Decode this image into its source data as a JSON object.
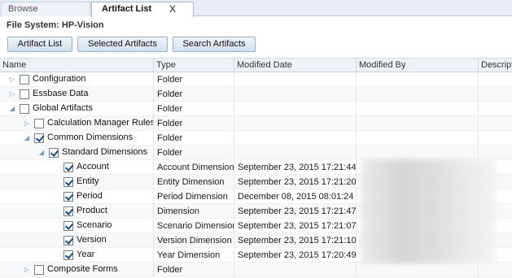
{
  "tabs": [
    {
      "label": "Browse"
    },
    {
      "label": "Artifact List",
      "close": "X"
    }
  ],
  "file_system_label": "File System: HP-Vision",
  "buttons": {
    "artifact_list": "Artifact List",
    "selected_artifacts": "Selected Artifacts",
    "search_artifacts": "Search Artifacts"
  },
  "columns": [
    "Name",
    "Type",
    "Modified Date",
    "Modified By",
    "Descript"
  ],
  "rows": [
    {
      "name": "Configuration",
      "type": "Folder",
      "date": "",
      "checked": false,
      "expander": "collapsed"
    },
    {
      "name": "Essbase Data",
      "type": "Folder",
      "date": "",
      "checked": false,
      "expander": "collapsed"
    },
    {
      "name": "Global Artifacts",
      "type": "Folder",
      "date": "",
      "checked": false,
      "expander": "expanded"
    },
    {
      "name": "Calculation Manager Rulesets",
      "type": "Folder",
      "date": "",
      "checked": false,
      "expander": "collapsed"
    },
    {
      "name": "Common Dimensions",
      "type": "Folder",
      "date": "",
      "checked": true,
      "expander": "expanded"
    },
    {
      "name": "Standard Dimensions",
      "type": "Folder",
      "date": "",
      "checked": true,
      "expander": "expanded"
    },
    {
      "name": "Account",
      "type": "Account Dimension",
      "date": "September 23, 2015 17:21:44",
      "checked": true,
      "expander": "none"
    },
    {
      "name": "Entity",
      "type": "Entity Dimension",
      "date": "September 23, 2015 17:21:20",
      "checked": true,
      "expander": "none"
    },
    {
      "name": "Period",
      "type": "Period Dimension",
      "date": "December 08, 2015 08:01:24",
      "checked": true,
      "expander": "none"
    },
    {
      "name": "Product",
      "type": "Dimension",
      "date": "September 23, 2015 17:21:47",
      "checked": true,
      "expander": "none"
    },
    {
      "name": "Scenario",
      "type": "Scenario Dimension",
      "date": "September 23, 2015 17:21:07",
      "checked": true,
      "expander": "none"
    },
    {
      "name": "Version",
      "type": "Version Dimension",
      "date": "September 23, 2015 17:21:10",
      "checked": true,
      "expander": "none"
    },
    {
      "name": "Year",
      "type": "Year Dimension",
      "date": "September 23, 2015 17:20:49",
      "checked": true,
      "expander": "none"
    },
    {
      "name": "Composite Forms",
      "type": "Folder",
      "date": "",
      "checked": false,
      "expander": "collapsed"
    }
  ]
}
